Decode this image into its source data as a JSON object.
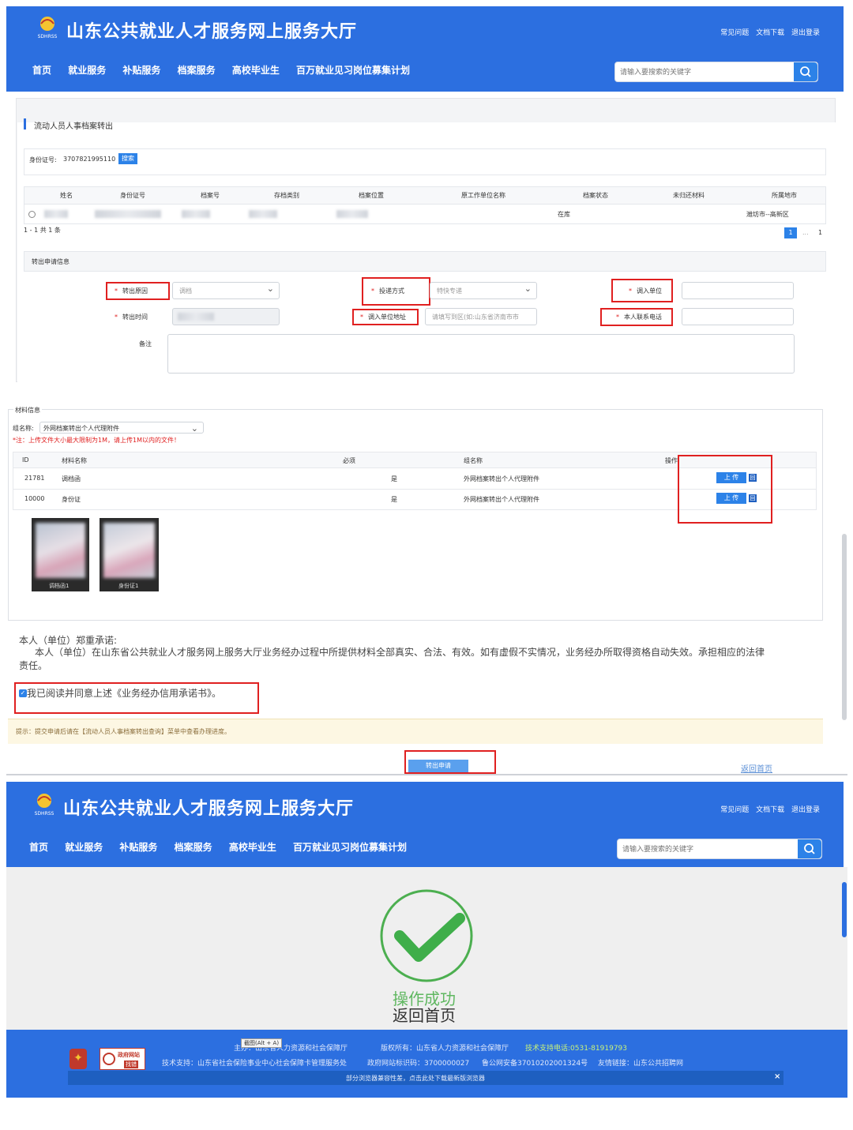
{
  "site": {
    "title": "山东公共就业人才服务网上服务大厅",
    "logo_text": "SDHRSS",
    "top_links": [
      "常见问题",
      "文档下载",
      "退出登录"
    ],
    "nav": [
      "首页",
      "就业服务",
      "补贴服务",
      "档案服务",
      "高校毕业生",
      "百万就业见习岗位募集计划"
    ],
    "search_placeholder": "请输入要搜索的关键字",
    "search_icon": "search-icon"
  },
  "form_page": {
    "section_title": "流动人员人事档案转出",
    "id_label": "身份证号:",
    "id_value": "3707821995110",
    "search_button": "搜索",
    "table_headers": [
      "姓名",
      "身份证号",
      "档案号",
      "存档类别",
      "档案位置",
      "原工作单位名称",
      "档案状态",
      "未归还材料",
      "所属地市"
    ],
    "table_row": {
      "status": "在库",
      "city": "潍坊市--高新区"
    },
    "pagination_summary": "1 - 1 共 1 条",
    "pagination": {
      "current": "1",
      "ellipsis": "...",
      "last": "1"
    },
    "apply_section": "转出申请信息",
    "fields": {
      "reason_label": "转出原因",
      "reason_value": "调档",
      "delivery_label": "投递方式",
      "delivery_value": "特快专递",
      "unit_label": "调入单位",
      "time_label": "转出时间",
      "address_label": "调入单位地址",
      "address_placeholder": "请填写到区(如:山东省济南市市",
      "phone_label": "本人联系电话",
      "remark_label": "备注"
    },
    "materials": {
      "section": "材料信息",
      "group_label": "组名称:",
      "group_value": "外网档案转出个人代理附件",
      "note": "*注：上传文件大小最大限制为1M，请上传1M以内的文件！",
      "headers": [
        "ID",
        "材料名称",
        "必须",
        "组名称",
        "操作"
      ],
      "rows": [
        {
          "id": "21781",
          "name": "调档函",
          "required": "是",
          "group": "外网档案转出个人代理附件",
          "upload": "上 传",
          "view": "回"
        },
        {
          "id": "10000",
          "name": "身份证",
          "required": "是",
          "group": "外网档案转出个人代理附件",
          "upload": "上 传",
          "view": "回"
        }
      ],
      "thumbs": [
        "调档函1",
        "身份证1"
      ]
    },
    "pledge_title": "本人（单位）郑重承诺:",
    "pledge_text": "本人（单位）在山东省公共就业人才服务网上服务大厅业务经办过程中所提供材料全部真实、合法、有效。如有虚假不实情况，业务经办所取得资格自动失效。承担相应的法律责任。",
    "agree_text": "我已阅读并同意上述《业务经办信用承诺书》。",
    "hint": "提示：提交申请后请在【流动人员人事档案转出查询】菜单中查看办理进度。",
    "submit_button": "转出申请",
    "return_link": "返回首页"
  },
  "success_page": {
    "success_text": "操作成功",
    "return_text": "返回首页",
    "check_icon": "check-circle-icon",
    "screenshot_tip": "截图(Alt + A)",
    "footer_line1": [
      "主办：山东省人力资源和社会保障厅",
      "版权所有：山东省人力资源和社会保障厅",
      "技术支持电话:0531-81919793"
    ],
    "footer_line2": [
      "技术支持：山东省社会保险事业中心社会保障卡管理服务处",
      "政府网站标识码：3700000027",
      "鲁公网安备37010202001324号",
      "友情链接：山东公共招聘网"
    ],
    "gov_badge": "政府网站",
    "gov_badge_sub": "找错",
    "browser_notice": "部分浏览器兼容性差，点击此处下载最新版浏览器",
    "close": "×"
  },
  "colors": {
    "header_blue": "#2c6fe0",
    "accent_red": "#e02020",
    "success_green": "#4caf50",
    "footer_blue": "#2c6fe0"
  }
}
